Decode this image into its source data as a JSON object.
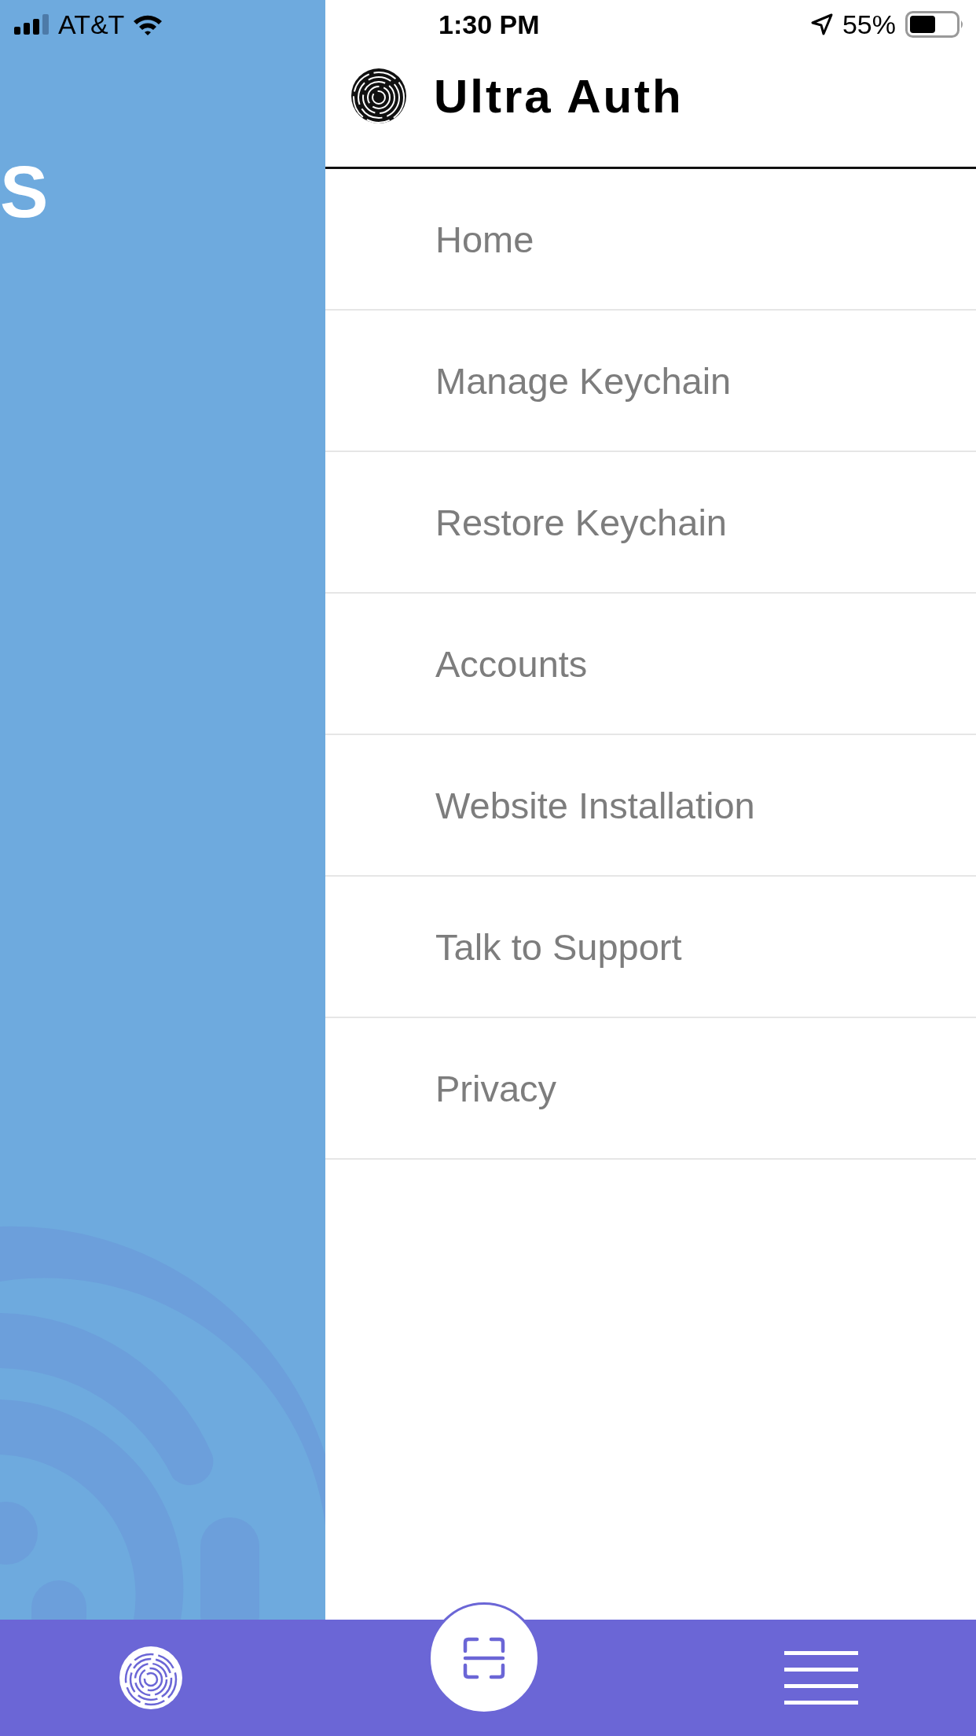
{
  "status_bar": {
    "carrier": "AT&T",
    "time": "1:30 PM",
    "battery": "55%"
  },
  "background": {
    "heading": "S"
  },
  "drawer": {
    "title": "Ultra Auth",
    "items": [
      {
        "label": "Home"
      },
      {
        "label": "Manage Keychain"
      },
      {
        "label": "Restore Keychain"
      },
      {
        "label": "Accounts"
      },
      {
        "label": "Website Installation"
      },
      {
        "label": "Talk to Support"
      },
      {
        "label": "Privacy"
      }
    ]
  }
}
